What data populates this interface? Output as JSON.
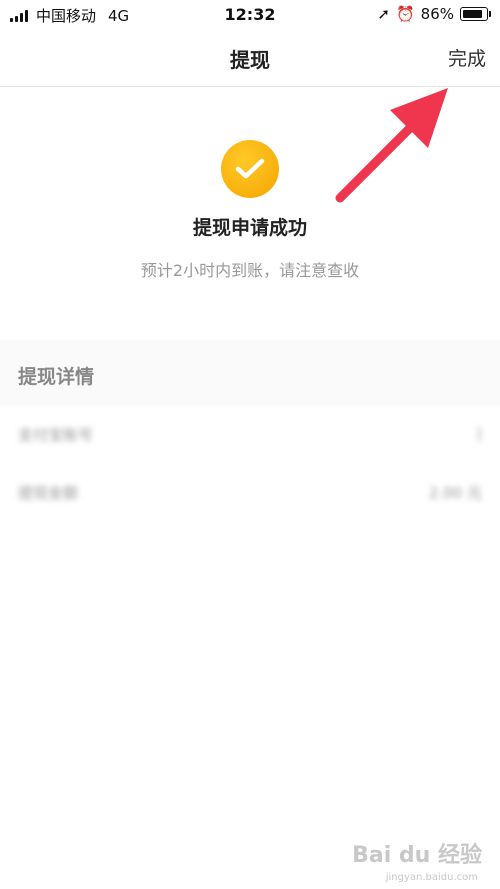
{
  "status_bar": {
    "carrier": "中国移动",
    "network": "4G",
    "time": "12:32",
    "battery": "86%"
  },
  "nav": {
    "title": "提现",
    "done_label": "完成"
  },
  "success": {
    "title": "提现申请成功",
    "subtitle": "预计2小时内到账，请注意查收",
    "icon_color": "#f5a500"
  },
  "details": {
    "section_title": "提现详情",
    "rows": [
      {
        "label": "支付宝账号",
        "value": "|"
      },
      {
        "label": "提现金额",
        "value": "2.00 元"
      }
    ]
  },
  "annotation": {
    "arrow_color": "#f0364f"
  },
  "watermark": {
    "brand": "Bai du 经验",
    "url": "jingyan.baidu.com"
  }
}
